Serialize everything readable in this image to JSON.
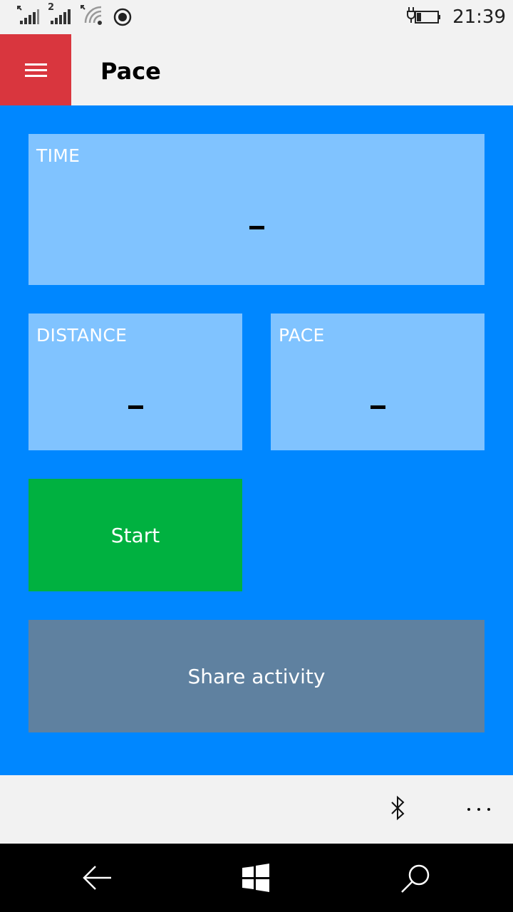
{
  "status_bar": {
    "time": "21:39",
    "icons": [
      "signal-icon",
      "signal-sim2-icon",
      "wifi-icon",
      "location-icon",
      "battery-charging-icon"
    ],
    "sim2_label": "2"
  },
  "header": {
    "title": "Pace",
    "menu_icon": "hamburger-icon",
    "accent_color": "#d9363e"
  },
  "tiles": {
    "time": {
      "label": "TIME",
      "value": "–"
    },
    "distance": {
      "label": "DISTANCE",
      "value": "–"
    },
    "pace": {
      "label": "PACE",
      "value": "–"
    }
  },
  "actions": {
    "start_label": "Start",
    "start_color": "#00b140",
    "share_label": "Share activity",
    "share_color": "#5f81a0"
  },
  "app_bar": {
    "icons": [
      "bluetooth-icon",
      "more-icon"
    ]
  },
  "nav_bar": {
    "icons": [
      "back-icon",
      "windows-icon",
      "search-icon"
    ]
  },
  "colors": {
    "main_background": "#0087ff",
    "tile_background": "#80c3ff"
  }
}
